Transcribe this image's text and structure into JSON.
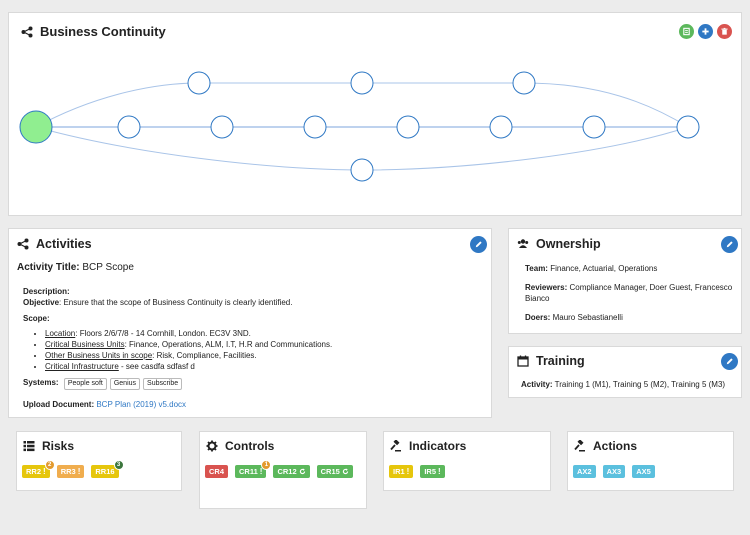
{
  "process": {
    "title": "Business Continuity",
    "buttons": {
      "export": "export-icon",
      "add": "plus-icon",
      "delete": "trash-icon"
    },
    "colors": {
      "export": "#5cb85c",
      "add": "#2f78c4",
      "delete": "#d9534f",
      "start_node": "#90ee90",
      "edge": "#a9c4e8",
      "node_border": "#2f78c4"
    }
  },
  "activities": {
    "title": "Activities",
    "activity_title_label": "Activity Title:",
    "activity_title_value": "BCP Scope",
    "description_label": "Description:",
    "objective_label": "Objective",
    "objective_text": ": Ensure that the scope of Business Continuity is clearly identified.",
    "scope_label": "Scope:",
    "scope_items": [
      {
        "label": "Location",
        "text": ": Floors 2/6/7/8 - 14 Cornhill, London. EC3V 3ND."
      },
      {
        "label": "Critical Business Units",
        "text": ": Finance, Operations, ALM, I.T, H.R and Communications."
      },
      {
        "label": "Other Business Units in scope",
        "text": ": Risk, Compliance, Facilities."
      },
      {
        "label": "Critical Infrastructure",
        "text": " - see casdfa sdfasf d"
      }
    ],
    "systems_label": "Systems:",
    "systems": [
      "People soft",
      "Genius",
      "Subscribe"
    ],
    "upload_label": "Upload Document:",
    "upload_file": "BCP Plan (2019) v5.docx"
  },
  "ownership": {
    "title": "Ownership",
    "team_label": "Team:",
    "team_value": "Finance, Actuarial, Operations",
    "reviewers_label": "Reviewers:",
    "reviewers_value": "Compliance Manager, Doer Guest, Francesco Bianco",
    "doers_label": "Doers:",
    "doers_value": "Mauro Sebastianelli"
  },
  "training": {
    "title": "Training",
    "activity_label": "Activity:",
    "activity_value": "Training 1 (M1), Training 5 (M2), Training 5 (M3)"
  },
  "risks": {
    "title": "Risks",
    "tags": [
      {
        "label": "RR2",
        "color": "#e6c60c",
        "bang": "!",
        "badge": "2",
        "badge_color": "#e39a2d"
      },
      {
        "label": "RR3",
        "color": "#f0ad4e",
        "bang": "!",
        "badge": "",
        "badge_color": ""
      },
      {
        "label": "RR16",
        "color": "#e6c60c",
        "bang": "",
        "badge": "3",
        "badge_color": "#3c763d"
      }
    ]
  },
  "controls": {
    "title": "Controls",
    "tags": [
      {
        "label": "CR4",
        "color": "#d9534f",
        "bang": "",
        "badge": "",
        "badge_color": "",
        "refresh": false
      },
      {
        "label": "CR11",
        "color": "#5cb85c",
        "bang": "!",
        "badge": "1",
        "badge_color": "#e39a2d",
        "refresh": false
      },
      {
        "label": "CR12",
        "color": "#5cb85c",
        "bang": "",
        "badge": "",
        "badge_color": "",
        "refresh": true
      },
      {
        "label": "CR15",
        "color": "#5cb85c",
        "bang": "",
        "badge": "",
        "badge_color": "",
        "refresh": true
      }
    ]
  },
  "indicators": {
    "title": "Indicators",
    "tags": [
      {
        "label": "IR1",
        "color": "#e6c60c",
        "bang": "!",
        "badge": "",
        "badge_color": ""
      },
      {
        "label": "IR5",
        "color": "#5cb85c",
        "bang": "!",
        "badge": "",
        "badge_color": ""
      }
    ]
  },
  "actions": {
    "title": "Actions",
    "tags": [
      {
        "label": "AX2",
        "color": "#5bc0de",
        "bang": "",
        "badge": "",
        "badge_color": ""
      },
      {
        "label": "AX3",
        "color": "#5bc0de",
        "bang": "",
        "badge": "",
        "badge_color": ""
      },
      {
        "label": "AX5",
        "color": "#5bc0de",
        "bang": "",
        "badge": "",
        "badge_color": ""
      }
    ]
  }
}
